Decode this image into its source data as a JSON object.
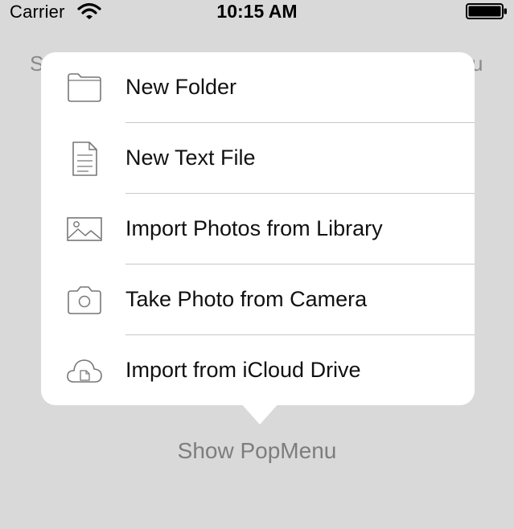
{
  "status_bar": {
    "carrier": "Carrier",
    "time": "10:15 AM",
    "wifi_icon": "wifi-icon",
    "battery_icon": "battery-icon"
  },
  "background": {
    "left_label": "S",
    "right_label": "u",
    "show_button": "Show PopMenu"
  },
  "popover": {
    "items": [
      {
        "label": "New Folder",
        "icon": "folder-icon"
      },
      {
        "label": "New Text File",
        "icon": "text-file-icon"
      },
      {
        "label": "Import Photos from Library",
        "icon": "photo-library-icon"
      },
      {
        "label": "Take Photo from Camera",
        "icon": "camera-icon"
      },
      {
        "label": "Import from iCloud Drive",
        "icon": "icloud-drive-icon"
      }
    ]
  },
  "colors": {
    "background": "#d9d9d9",
    "popover": "#ffffff",
    "icon_stroke": "#777777",
    "button_text": "#7d7d7d"
  }
}
